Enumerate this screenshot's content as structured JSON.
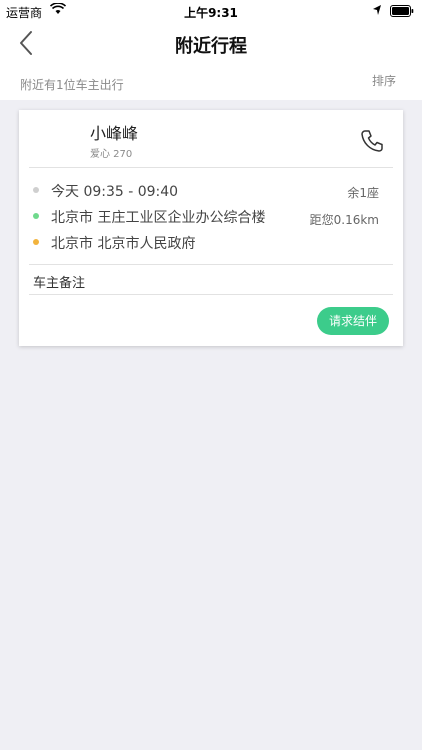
{
  "status_bar": {
    "carrier": "运营商",
    "time": "上午9:31"
  },
  "nav": {
    "title": "附近行程"
  },
  "sub_header": {
    "count_text": "附近有1位车主出行",
    "sort_label": "排序"
  },
  "trip": {
    "driver_name": "小峰峰",
    "love": "爱心 270",
    "time": "今天 09:35 - 09:40",
    "seats": "余1座",
    "origin": "北京市 王庄工业区企业办公综合楼",
    "distance": "距您0.16km",
    "destination": "北京市 北京市人民政府",
    "remark_label": "车主备注",
    "join_label": "请求结伴"
  },
  "colors": {
    "accent_green": "#3ccc8b",
    "origin_dot": "#6fd98c",
    "dest_dot": "#f2b33d",
    "time_dot": "#cfcfcf"
  }
}
